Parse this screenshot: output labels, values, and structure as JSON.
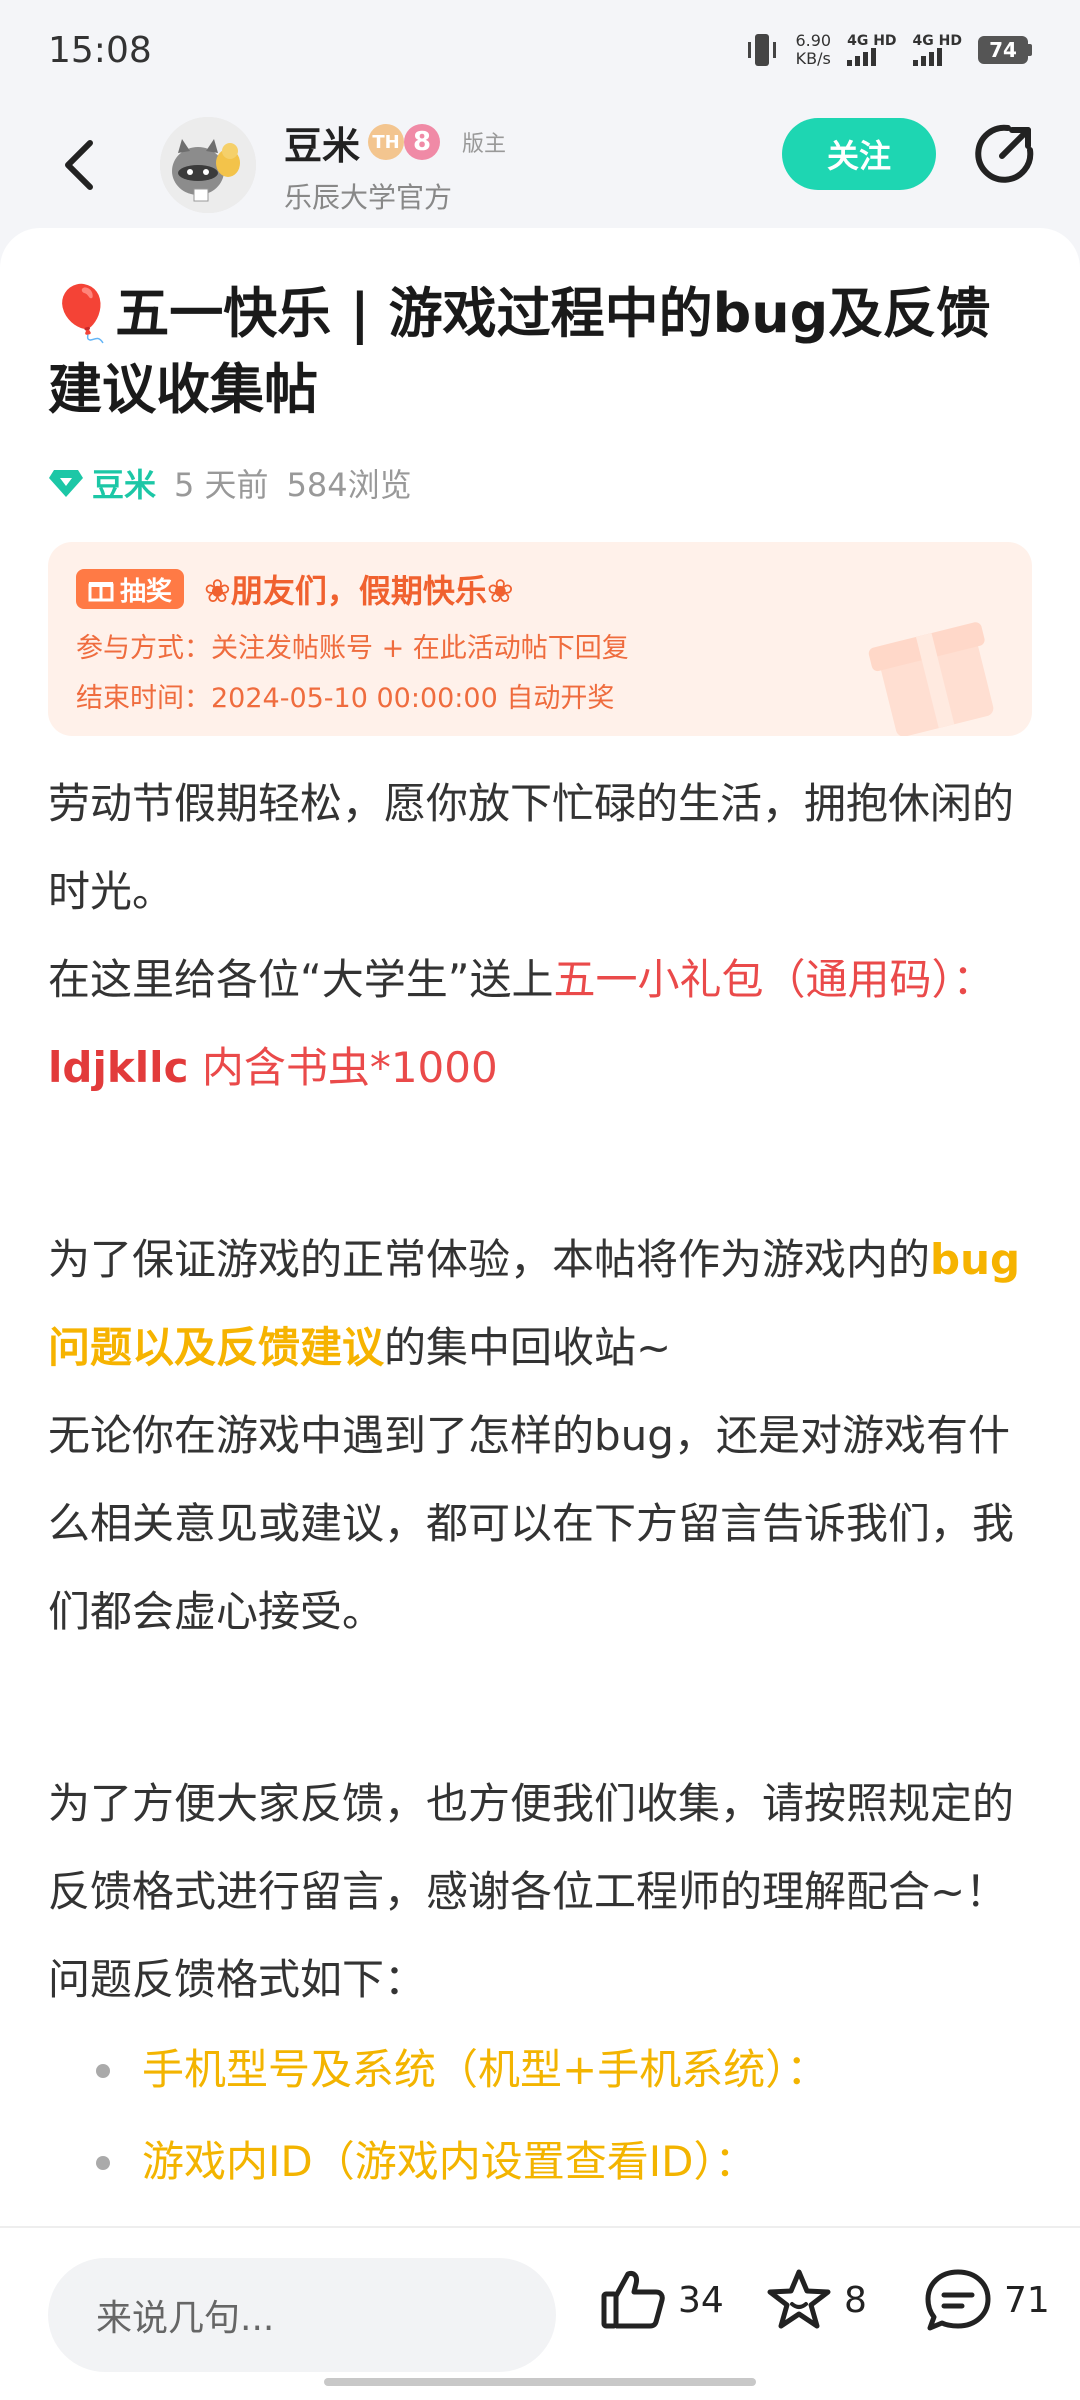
{
  "status_bar": {
    "time": "15:08",
    "net_speed_value": "6.90",
    "net_speed_unit": "KB/s",
    "sim1": "4G HD",
    "sim2": "4G HD",
    "battery": "74"
  },
  "header": {
    "author_name": "豆米",
    "level_badge_1": "TH",
    "level_badge_2": "8",
    "role_tag": "版主",
    "author_subtitle": "乐辰大学官方",
    "follow_label": "关注"
  },
  "post": {
    "title_emoji": "🎈",
    "title": "五一快乐 | 游戏过程中的bug及反馈建议收集帖",
    "meta_author": "豆米",
    "meta_time": "5 天前",
    "meta_views": "584浏览"
  },
  "lottery": {
    "tag": "抽奖",
    "headline": "❀朋友们，假期快乐❀",
    "join_method": "参与方式：关注发帖账号 + 在此活动帖下回复",
    "end_time": "结束时间：2024-05-10 00:00:00 自动开奖"
  },
  "content": {
    "p1": "劳动节假期轻松，愿你放下忙碌的生活，拥抱休闲的时光。",
    "p2_prefix": "在这里给各位“大学生”送上",
    "p2_gift": "五一小礼包（通用码）：",
    "p2_code": "ldjkllc",
    "p2_contents": " 内含书虫*1000",
    "p3_prefix": "为了保证游戏的正常体验，本帖将作为游戏内的",
    "p3_highlight": "bug问题以及反馈建议",
    "p3_suffix": "的集中回收站~",
    "p4": "无论你在游戏中遇到了怎样的bug，还是对游戏有什么相关意见或建议，都可以在下方留言告诉我们，我们都会虚心接受。",
    "p5": "为了方便大家反馈，也方便我们收集，请按照规定的反馈格式进行留言，感谢各位工程师的理解配合~！问题反馈格式如下：",
    "bullets": [
      "手机型号及系统（机型+手机系统）：",
      "游戏内ID（游戏内设置查看ID）："
    ]
  },
  "bottom_bar": {
    "comment_placeholder": "来说几句...",
    "likes": "34",
    "favorites": "8",
    "comments": "71"
  },
  "colors": {
    "accent": "#1ed6b2",
    "red_text": "#ea4a4a",
    "highlight_yellow": "#f6b300",
    "lottery_bg": "#fff1ea",
    "lottery_text": "#ef6c3e"
  }
}
